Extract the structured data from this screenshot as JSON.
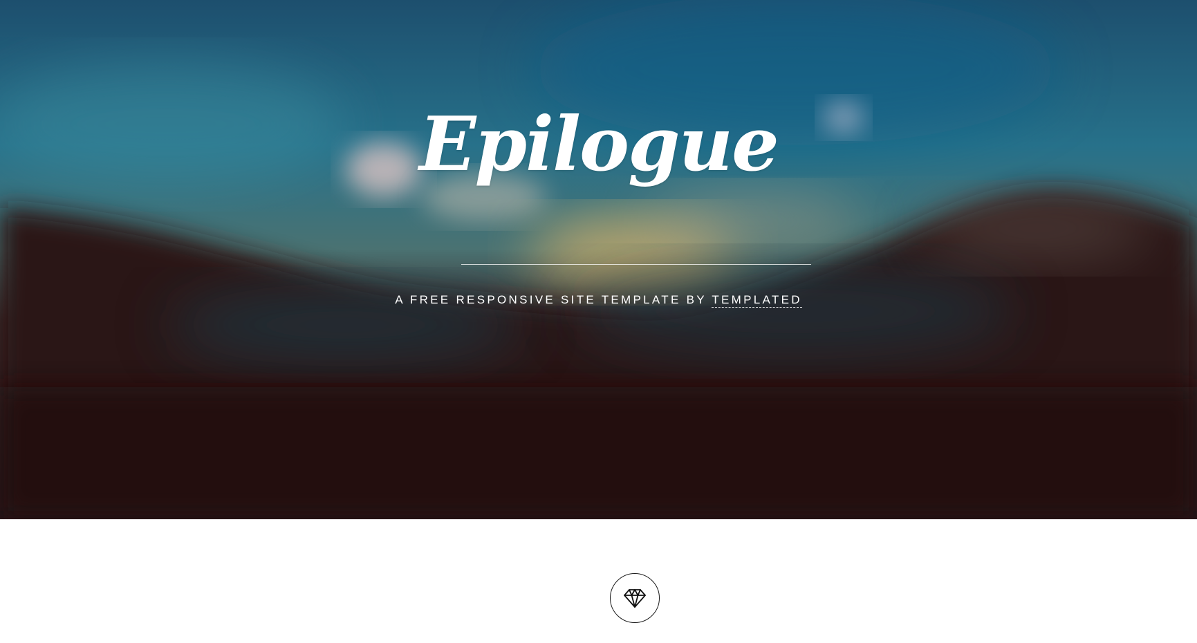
{
  "banner": {
    "title": "Epilogue",
    "tagline_prefix": "A FREE RESPONSIVE SITE TEMPLATE BY ",
    "tagline_link": "TEMPLATED",
    "colors": {
      "sky_top": "#1b5a7c",
      "sky_mid": "#2b6f86",
      "glow": "#f2c16a",
      "ground": "#23070d"
    }
  },
  "feature": {
    "icon": "diamond-icon",
    "border_color": "#1a1a1a"
  }
}
